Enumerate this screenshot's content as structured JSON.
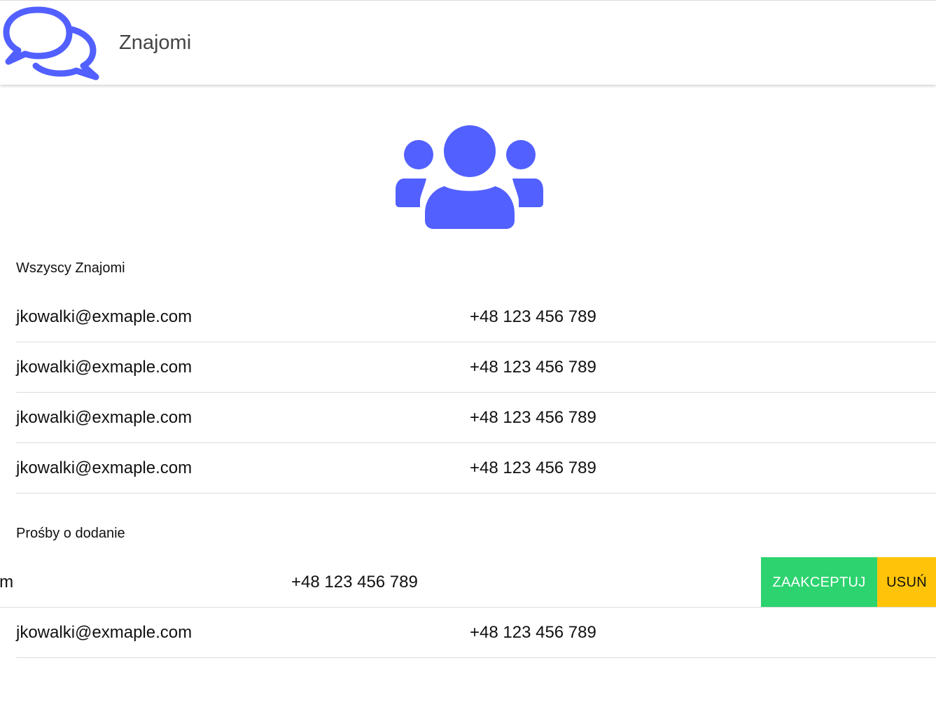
{
  "header": {
    "title": "Znajomi",
    "accent_color": "#5260ff",
    "logo_icon": "chat-bubbles-icon"
  },
  "hero": {
    "icon": "people-icon"
  },
  "friends": {
    "label": "Wszyscy Znajomi",
    "items": [
      {
        "email": "jkowalki@exmaple.com",
        "phone": "+48 123 456 789"
      },
      {
        "email": "jkowalki@exmaple.com",
        "phone": "+48 123 456 789"
      },
      {
        "email": "jkowalki@exmaple.com",
        "phone": "+48 123 456 789"
      },
      {
        "email": "jkowalki@exmaple.com",
        "phone": "+48 123 456 789"
      }
    ]
  },
  "requests": {
    "label": "Prośby o dodanie",
    "items": [
      {
        "email": "jkowalki@exmaple.com",
        "phone": "+48 123 456 789",
        "accept_label": "ZAAKCEPTUJ",
        "delete_label": "USUŃ",
        "accept_color": "#2dd36f",
        "delete_color": "#ffc409"
      },
      {
        "email": "jkowalki@exmaple.com",
        "phone": "+48 123 456 789"
      }
    ]
  }
}
